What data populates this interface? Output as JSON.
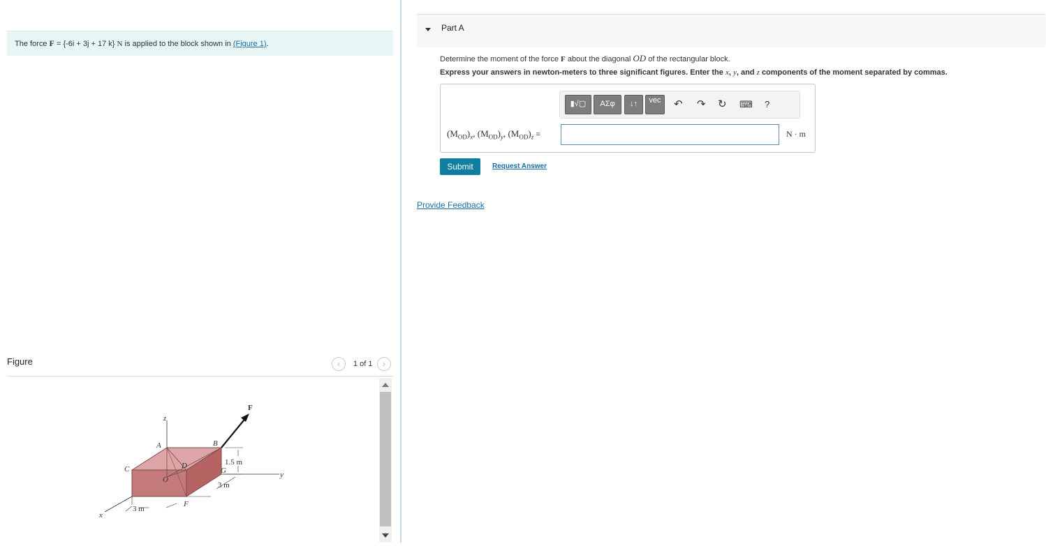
{
  "problem": {
    "text_before": "The force",
    "force_symbol": "F",
    "equals": "=",
    "vector": "{-6i + 3j + 17 k}",
    "unit": "N",
    "text_after": "is applied to the block shown in",
    "figure_link": "(Figure 1)",
    "period": "."
  },
  "figure": {
    "title": "Figure",
    "pager": "1 of 1",
    "prev_icon": "chevron-left-icon",
    "next_icon": "chevron-right-icon",
    "labels": {
      "F": "F",
      "z": "z",
      "A": "A",
      "B": "B",
      "C": "C",
      "D": "D",
      "O": "O",
      "G": "G",
      "x": "x",
      "y": "y",
      "F_point": "F",
      "dim_h": "1.5 m",
      "dim_w": "3 m",
      "dim_l": "3 m"
    }
  },
  "part": {
    "title": "Part A",
    "question_pre": "Determine the moment of the force",
    "question_force": "F",
    "question_mid": "about the diagonal",
    "question_diag": "OD",
    "question_post": "of the rectangular block.",
    "instruction_pre": "Express your answers in newton-meters to three significant figures. Enter the",
    "instruction_x": "x",
    "instruction_y": "y",
    "instruction_z": "z",
    "instruction_sep1": ",",
    "instruction_sep2": ", and",
    "instruction_post": "components of the moment separated by commas."
  },
  "answer": {
    "label_x": "(M",
    "label_sub": "OD",
    "label_x_axis": "x",
    "label_y_axis": "y",
    "label_z_axis": "z",
    "equals": "=",
    "value": "",
    "units": "N · m"
  },
  "toolbar": {
    "templates": "▮√▢",
    "greek": "ΑΣφ",
    "arrows": "↓↑",
    "vec": "vec",
    "undo_icon": "undo-icon",
    "redo_icon": "redo-icon",
    "reset_icon": "reset-icon",
    "keyboard_icon": "keyboard-icon",
    "help": "?"
  },
  "actions": {
    "submit": "Submit",
    "request_answer": "Request Answer",
    "feedback": "Provide Feedback"
  },
  "colors": {
    "submit_bg": "#0f7ea0",
    "link": "#1a6ea5",
    "block_top": "#dda5a5",
    "block_front": "#c47a7a",
    "block_side": "#b56363"
  }
}
